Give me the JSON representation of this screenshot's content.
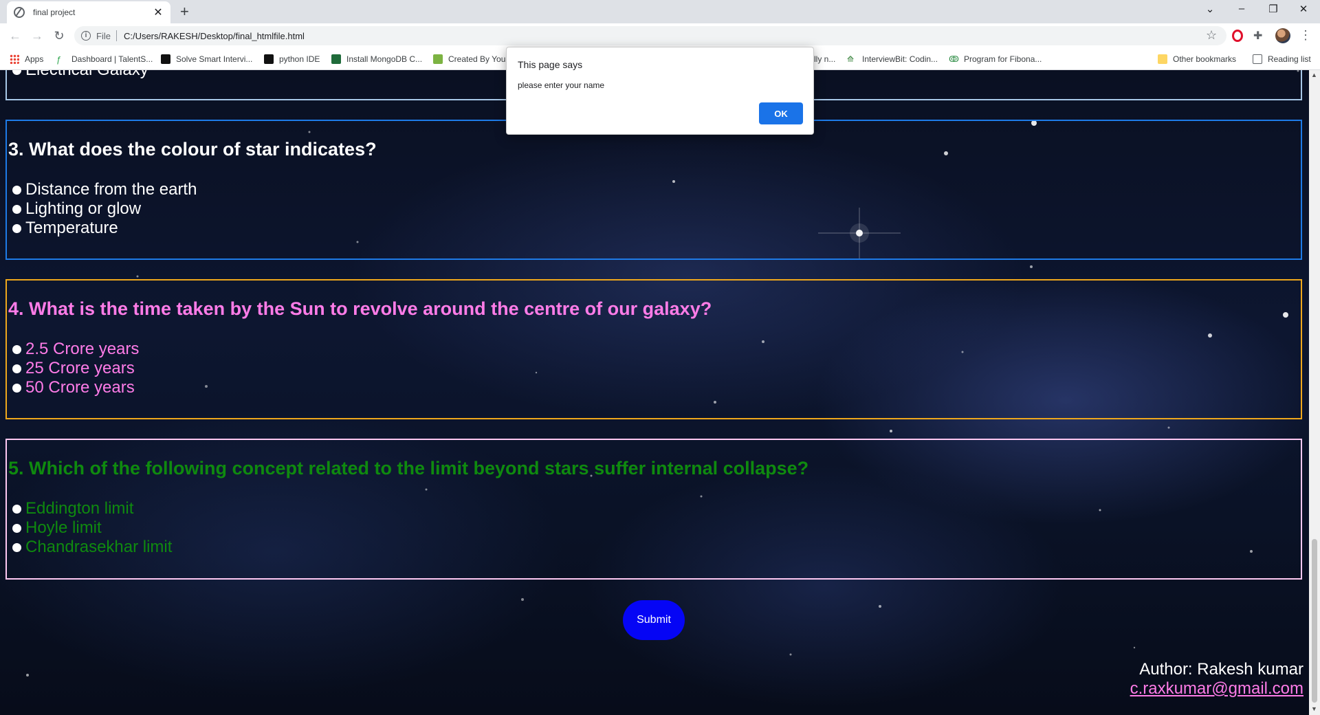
{
  "browser": {
    "tab_title": "final project",
    "new_tab": "+",
    "address_scheme": "File",
    "address_url": "C:/Users/RAKESH/Desktop/final_htmlfile.html",
    "bookmarks": [
      {
        "label": "Apps",
        "icon": "apps-grid-icon",
        "color": "#ea4335"
      },
      {
        "label": "Dashboard | TalentS...",
        "icon": "talent-icon",
        "color": "#34a853"
      },
      {
        "label": "Solve Smart Intervi...",
        "icon": "interview-icon",
        "color": "#111111"
      },
      {
        "label": "python IDE",
        "icon": "python-ide-icon",
        "color": "#111111"
      },
      {
        "label": "Install MongoDB C...",
        "icon": "mongodb-icon",
        "color": "#1f6b3a"
      },
      {
        "label": "Created By You",
        "icon": "created-icon",
        "color": "#7cb342"
      },
      {
        "label": "lly n...",
        "icon": "",
        "color": ""
      },
      {
        "label": "InterviewBit: Codin...",
        "icon": "interviewbit-icon",
        "color": "#2e7d32"
      },
      {
        "label": "Program for Fibona...",
        "icon": "gfg-icon",
        "color": "#2f8d46"
      }
    ],
    "other_bookmarks": "Other bookmarks",
    "reading_list": "Reading list"
  },
  "page": {
    "partial_option": "Electrical Galaxy",
    "questions": [
      {
        "title": "3. What does the colour of star indicates?",
        "color": "#ffffff",
        "border": "#1e7be8",
        "options": [
          "Distance from the earth",
          "Lighting or glow",
          "Temperature"
        ]
      },
      {
        "title": "4. What is the time taken by the Sun to revolve around the centre of our galaxy?",
        "color": "#ff7ce8",
        "border": "#f0a81c",
        "options": [
          "2.5 Crore years",
          "25 Crore years",
          "50 Crore years"
        ]
      },
      {
        "title": "5. Which of the following concept related to the limit beyond stars suffer internal collapse?",
        "color": "#0f8a0f",
        "border": "#ffc9f3",
        "options": [
          "Eddington limit",
          "Hoyle limit",
          "Chandrasekhar limit"
        ]
      }
    ],
    "submit_label": "Submit",
    "author": "Author: Rakesh kumar",
    "email": "c.raxkumar@gmail.com"
  },
  "dialog": {
    "title": "This page says",
    "message": "please enter your name",
    "ok_label": "OK"
  }
}
